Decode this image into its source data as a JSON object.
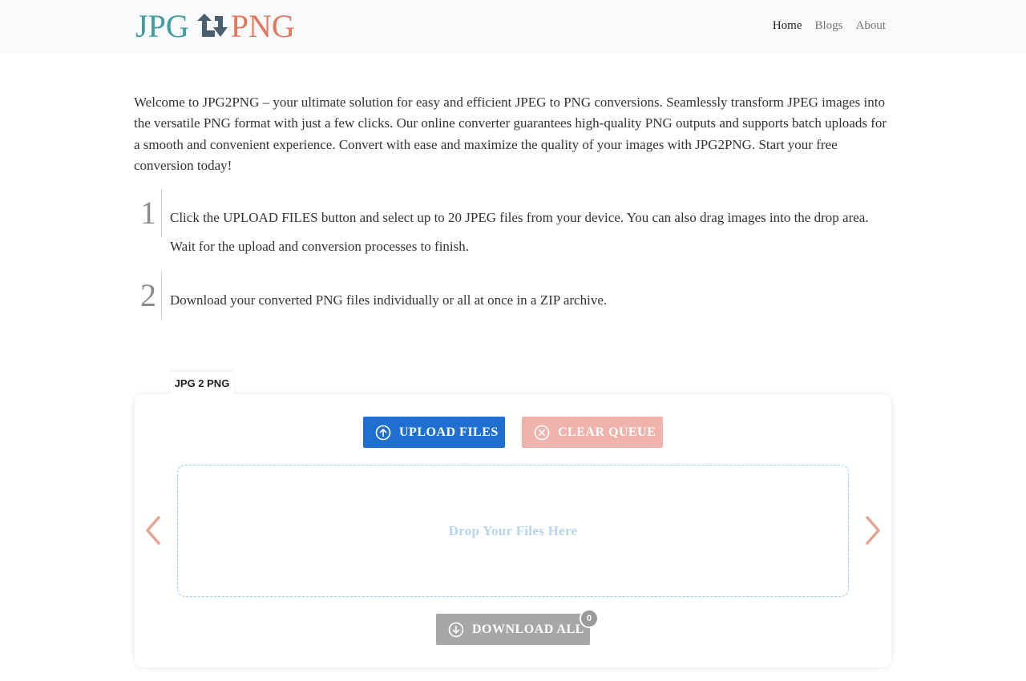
{
  "header": {
    "logo_left": "JPG",
    "logo_right": "PNG",
    "nav": [
      {
        "label": "Home"
      },
      {
        "label": "Blogs"
      },
      {
        "label": "About"
      }
    ]
  },
  "intro": {
    "text": "Welcome to JPG2PNG – your ultimate solution for easy and efficient JPEG to PNG conversions. Seamlessly transform JPEG images into the versatile PNG format with just a few clicks. Our online converter guarantees high-quality PNG outputs and supports batch uploads for a smooth and convenient experience. Convert with ease and maximize the quality of your images with JPG2PNG. Start your free conversion today!"
  },
  "steps": [
    {
      "number": "1",
      "text": "Click the UPLOAD FILES button and select up to 20 JPEG files from your device. You can also drag images into the drop area. Wait for the upload and conversion processes to finish."
    },
    {
      "number": "2",
      "text": "Download your converted PNG files individually or all at once in a ZIP archive."
    }
  ],
  "converter": {
    "tab_label": "JPG 2 PNG",
    "upload_label": "UPLOAD FILES",
    "clear_label": "CLEAR QUEUE",
    "drop_text": "Drop Your Files Here",
    "download_label": "DOWNLOAD ALL",
    "download_count": "0"
  },
  "icons": {
    "logo": "convert-arrows-icon",
    "upload": "arrow-up-circle-icon",
    "clear": "x-circle-icon",
    "download": "arrow-down-circle-icon",
    "prev": "chevron-left-icon",
    "next": "chevron-right-icon"
  },
  "colors": {
    "primary": "#1f6fd0",
    "accent": "#e07860",
    "teal": "#3d9ca0",
    "clear_button": "#eeb4ab",
    "disabled": "#a7a7a7"
  }
}
